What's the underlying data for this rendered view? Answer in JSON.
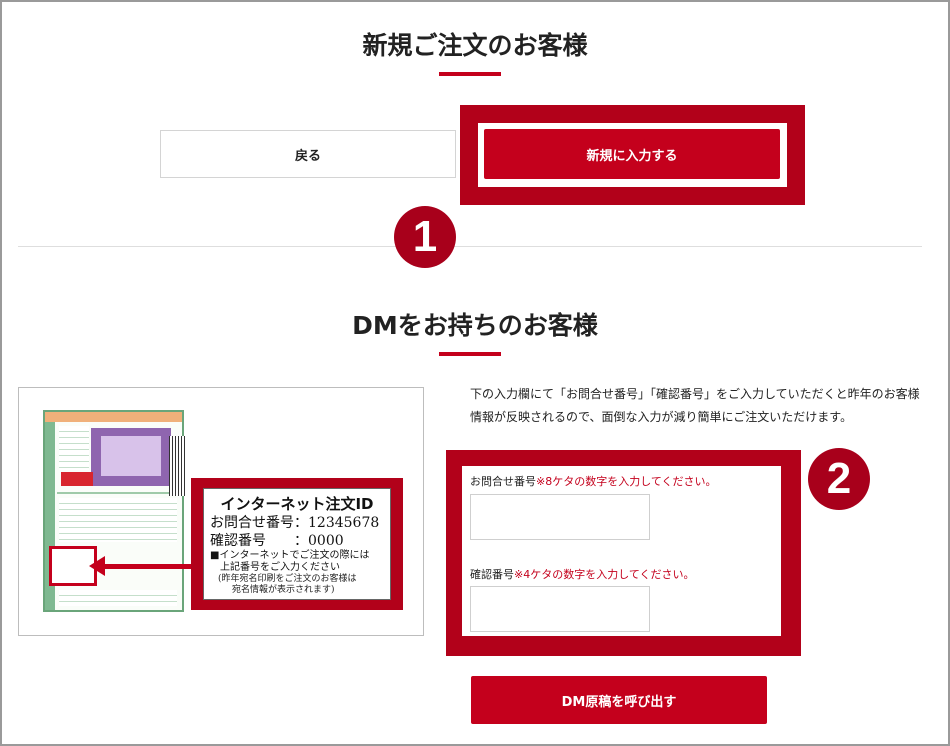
{
  "new_customer": {
    "title": "新規ご注文のお客様",
    "back_label": "戻る",
    "new_entry_label": "新規に入力する",
    "step_number": "1"
  },
  "dm_customer": {
    "title": "DMをお持ちのお客様",
    "description": "下の入力欄にて「お問合せ番号」「確認番号」をご入力していただくと昨年のお客様情報が反映されるので、面倒な入力が減り簡単にご注文いただけます。",
    "step_number": "2",
    "inquiry": {
      "label": "お問合せ番号",
      "note": "※8ケタの数字を入力してください。",
      "value": "",
      "placeholder": ""
    },
    "confirm": {
      "label": "確認番号",
      "note": "※4ケタの数字を入力してください。",
      "value": "",
      "placeholder": ""
    },
    "submit_label": "DM原稿を呼び出す"
  },
  "sample_image": {
    "title": "インターネット注文ID",
    "inquiry_row": "お問合せ番号：12345678",
    "confirm_row": "確認番号　　：0000",
    "note_line1": "■インターネットでご注文の際には",
    "note_line2": "上記番号をご入力ください",
    "small_line1": "(昨年宛名印刷をご注文のお客様は",
    "small_line2": "宛名情報が表示されます)"
  },
  "colors": {
    "accent": "#c4001c",
    "highlight": "#b2011a",
    "badge": "#a8001b"
  }
}
